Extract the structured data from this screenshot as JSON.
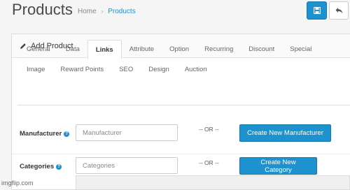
{
  "header": {
    "title": "Products",
    "breadcrumb": [
      {
        "label": "Home"
      },
      {
        "label": "Products"
      }
    ],
    "breadcrumb_separator": "›",
    "save_icon": "save-icon",
    "back_icon": "reply-icon"
  },
  "panel": {
    "heading": "Add Product",
    "heading_icon": "pencil-icon"
  },
  "tabs": {
    "row1": [
      "General",
      "Data",
      "Links",
      "Attribute",
      "Option",
      "Recurring",
      "Discount",
      "Special"
    ],
    "row2": [
      "Image",
      "Reward Points",
      "SEO",
      "Design",
      "Auction"
    ],
    "active": "Links"
  },
  "form": {
    "manufacturer": {
      "label": "Manufacturer",
      "placeholder": "Manufacturer",
      "value": "",
      "or_text": "-- OR --",
      "button": "Create New Manufacturer"
    },
    "categories": {
      "label": "Categories",
      "placeholder": "Categories",
      "value": "",
      "or_text": "-- OR --",
      "button": "Create New Category"
    },
    "help_glyph": "?"
  },
  "watermark": "imgflip.com",
  "colors": {
    "primary": "#1e91cf",
    "background": "#f5f5f5"
  }
}
